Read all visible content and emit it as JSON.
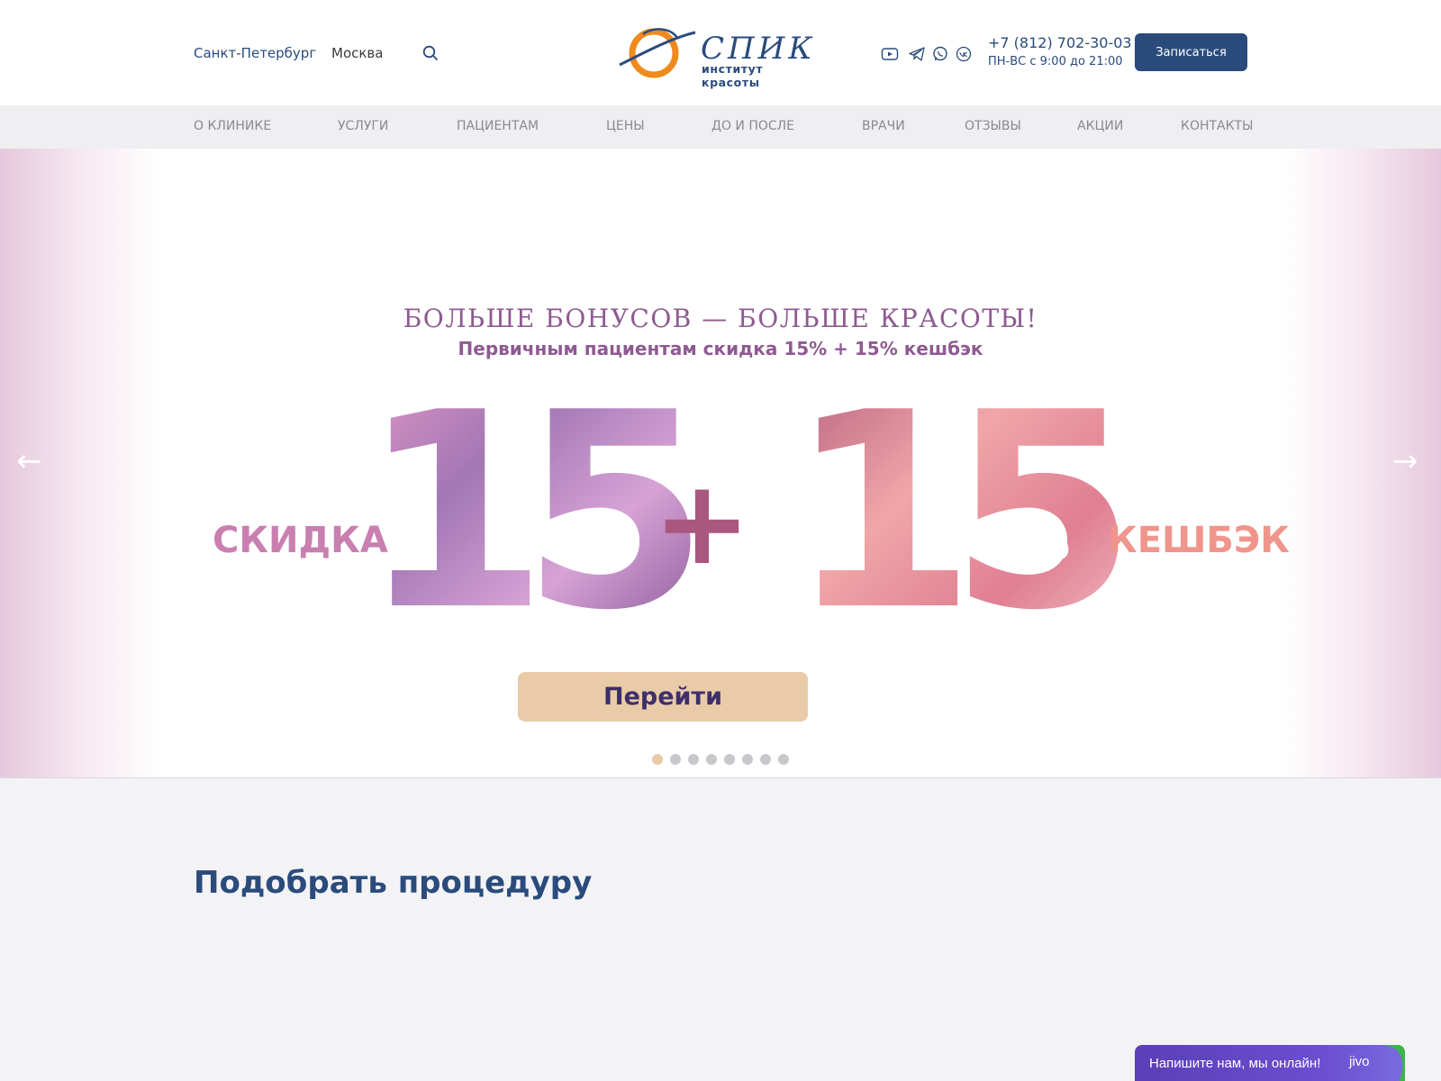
{
  "header": {
    "cities": [
      "Санкт-Петербург",
      "Москва"
    ],
    "logo": {
      "name": "СПИК",
      "tagline": "институт красоты"
    },
    "social_icons": [
      "youtube-icon",
      "telegram-icon",
      "whatsapp-icon",
      "vk-icon"
    ],
    "phone": "+7 (812) 702-30-03",
    "hours": "ПН-ВС с 9:00 до 21:00",
    "cta_label": "Записаться"
  },
  "nav": {
    "items": [
      "О КЛИНИКЕ",
      "УСЛУГИ",
      "ПАЦИЕНТАМ",
      "ЦЕНЫ",
      "ДО И ПОСЛЕ",
      "ВРАЧИ",
      "ОТЗЫВЫ",
      "АКЦИИ",
      "КОНТАКТЫ"
    ]
  },
  "hero": {
    "title": "БОЛЬШЕ БОНУСОВ — БОЛЬШЕ КРАСОТЫ!",
    "subtitle": "Первичным пациентам скидка 15% + 15% кешбэк",
    "left_label": "СКИДКА",
    "right_label": "КЕШБЭК",
    "num1": "15",
    "num2": "15",
    "percent": "%",
    "plus": "+",
    "button_label": "Перейти",
    "arrow_left": "←",
    "arrow_right": "→",
    "slide_count": 8,
    "active_slide": 1
  },
  "section": {
    "title": "Подобрать процедуру"
  },
  "chat": {
    "text": "Напишите нам, мы онлайн!",
    "brand": "jivo"
  },
  "colors": {
    "brand_blue": "#2a4b7c",
    "accent_orange": "#f08a1c",
    "hero_purple": "#8e5a91",
    "hero_button": "#e9cba8",
    "pink_label": "#c97fb0",
    "coral_label": "#f0958c",
    "chat_purple": "#5a3fb8"
  }
}
